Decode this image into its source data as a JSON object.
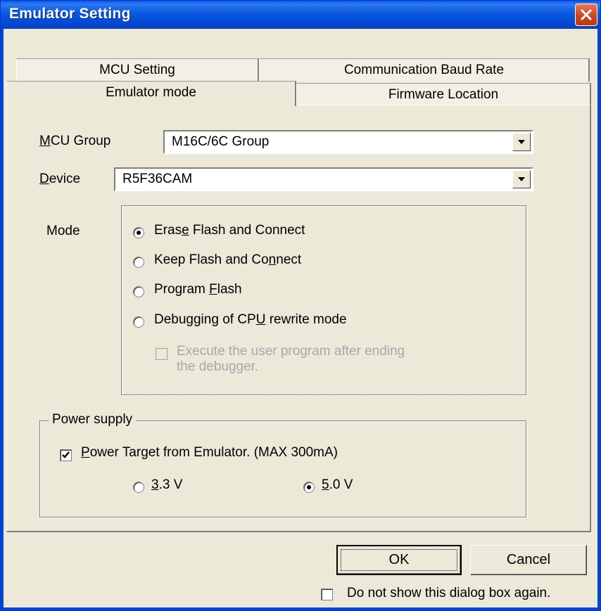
{
  "window": {
    "title": "Emulator Setting",
    "close_icon": "close-icon"
  },
  "tabs": {
    "mcu_setting": "MCU Setting",
    "baud_rate": "Communication Baud Rate",
    "emulator_mode": "Emulator mode",
    "firmware_location": "Firmware Location"
  },
  "mcu_group": {
    "label_m": "M",
    "label_rest": "CU Group",
    "value": "M16C/6C Group"
  },
  "device": {
    "label_d": "D",
    "label_rest": "evice",
    "value": "R5F36CAM"
  },
  "mode": {
    "label": "Mode",
    "options": [
      {
        "pre": "Eras",
        "u": "e",
        "post": " Flash and Connect",
        "selected": true
      },
      {
        "pre": "Keep Flash and Co",
        "u": "n",
        "post": "nect",
        "selected": false
      },
      {
        "pre": "Program ",
        "u": "F",
        "post": "lash",
        "selected": false
      },
      {
        "pre": "Debugging of CP",
        "u": "U",
        "post": " rewrite mode",
        "selected": false
      }
    ],
    "execute_line1": "Execute the user program after ending",
    "execute_line2": "the debugger.",
    "execute_checked": false,
    "execute_enabled": false
  },
  "power": {
    "legend": "Power supply",
    "checked": true,
    "label_p": "P",
    "label_rest": "ower Target from Emulator. (MAX 300mA)",
    "v33_u": "3",
    "v33_rest": ".3 V",
    "v50_u": "5",
    "v50_rest": ".0 V",
    "selected": "5.0 V"
  },
  "buttons": {
    "ok": "OK",
    "cancel": "Cancel"
  },
  "dont_show": {
    "label": "Do not show this dialog box again.",
    "checked": false
  },
  "colors": {
    "titlebar": "#0a5be3",
    "face": "#ece9d8",
    "close": "#c9421f"
  }
}
